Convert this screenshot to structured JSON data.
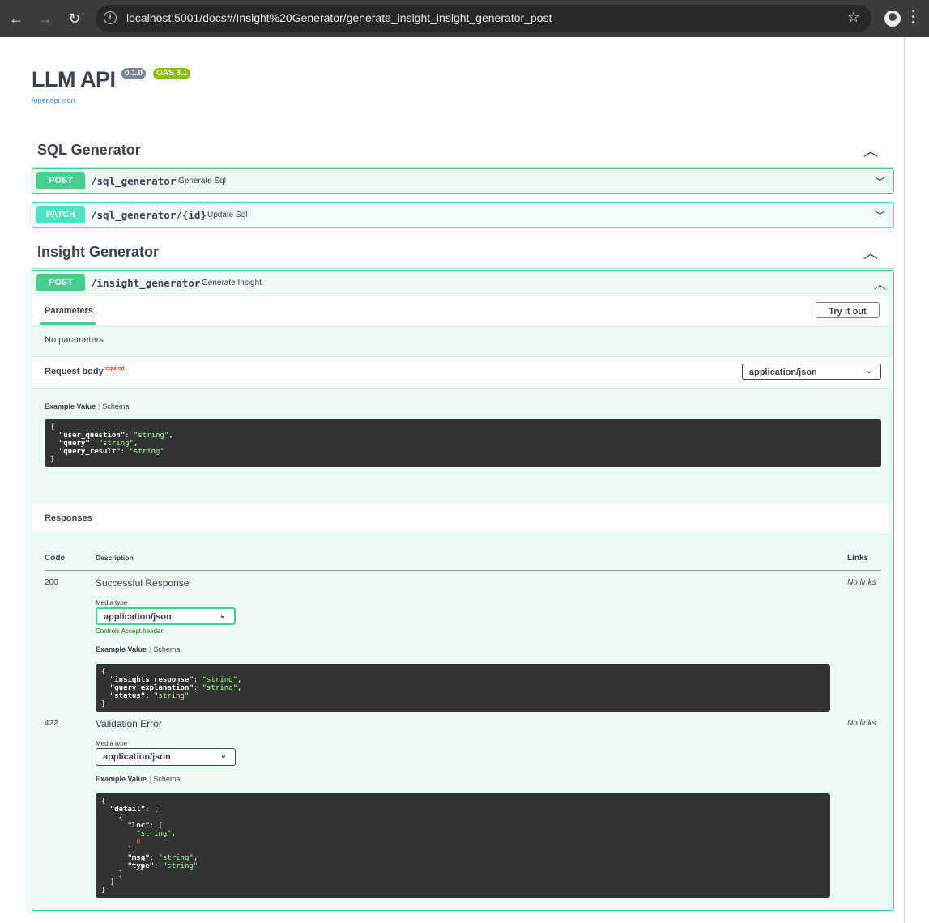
{
  "browser": {
    "url": "localhost:5001/docs#/Insight%20Generator/generate_insight_insight_generator_post",
    "back_icon": "←",
    "forward_icon": "→",
    "reload_icon": "↻",
    "star_icon": "☆"
  },
  "api": {
    "title": "LLM API",
    "version": "0.1.0",
    "oas": "OAS 3.1",
    "spec_link": "/openapi.json"
  },
  "tags": [
    {
      "name": "SQL Generator",
      "operations": [
        {
          "method": "POST",
          "path": "/sql_generator",
          "summary": "Generate Sql"
        },
        {
          "method": "PATCH",
          "path": "/sql_generator/{id}",
          "summary": "Update Sql"
        }
      ]
    },
    {
      "name": "Insight Generator",
      "operations": [
        {
          "method": "POST",
          "path": "/insight_generator",
          "summary": "Generate Insight"
        }
      ]
    }
  ],
  "expanded": {
    "parameters_tab": "Parameters",
    "try_button": "Try it out",
    "no_params": "No parameters",
    "request_body_label": "Request body",
    "required_label": "required",
    "content_type": "application/json",
    "example_tab": "Example Value",
    "schema_tab": "Schema",
    "responses_label": "Responses",
    "col_code": "Code",
    "col_description": "Description",
    "col_links": "Links",
    "media_type_label": "Media type",
    "controls_note": "Controls Accept header.",
    "no_links": "No links",
    "responses": [
      {
        "code": "200",
        "description": "Successful Response",
        "media": "application/json"
      },
      {
        "code": "422",
        "description": "Validation Error",
        "media": "application/json"
      }
    ]
  },
  "colors": {
    "post": "#49cc90",
    "patch": "#50e3c2",
    "code_bg": "#333333",
    "string": "#a2fca2",
    "number": "#d36363"
  }
}
